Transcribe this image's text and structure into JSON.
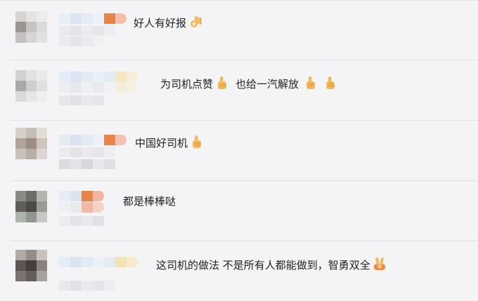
{
  "comments": [
    {
      "text": "好人有好报",
      "suffix": "",
      "emoji": [
        "ok-hand-icon"
      ]
    },
    {
      "text": "为司机点赞",
      "suffix": "也给一汽解放",
      "emoji": [
        "thumbs-up-icon",
        "thumbs-up-icon",
        "thumbs-up-icon"
      ]
    },
    {
      "text": "中国好司机",
      "suffix": "",
      "emoji": [
        "thumbs-up-icon"
      ]
    },
    {
      "text": "都是棒棒哒",
      "suffix": "",
      "emoji": []
    },
    {
      "text": "这司机的做法 不是所有人都能做到，智勇双全",
      "suffix": "",
      "emoji": [
        "victory-hand-icon"
      ]
    }
  ],
  "colors": {
    "background": "#f4f4f6",
    "divider": "#e0e0e4",
    "text": "#222222",
    "accent_blur": "#e8834a"
  }
}
